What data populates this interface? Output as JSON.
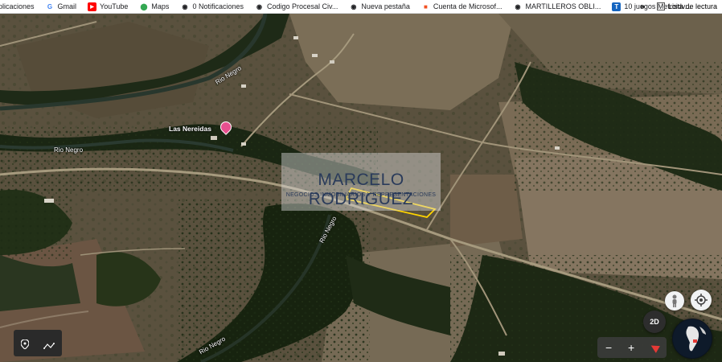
{
  "bookmarks": [
    {
      "label": "plicaciones",
      "icon": "apps-icon",
      "color": "#4285f4"
    },
    {
      "label": "Gmail",
      "icon": "google-icon",
      "color": "#4285f4"
    },
    {
      "label": "YouTube",
      "icon": "youtube-icon",
      "color": "#ff0000"
    },
    {
      "label": "Maps",
      "icon": "maps-icon",
      "color": "#34a853"
    },
    {
      "label": "0 Notificaciones",
      "icon": "globe-icon",
      "color": "#202124"
    },
    {
      "label": "Codigo Procesal Civ...",
      "icon": "globe-icon",
      "color": "#202124"
    },
    {
      "label": "Nueva pestaña",
      "icon": "globe-icon",
      "color": "#202124"
    },
    {
      "label": "Cuenta de Microsof...",
      "icon": "microsoft-icon",
      "color": "#f25022"
    },
    {
      "label": "MARTILLEROS OBLI...",
      "icon": "globe-icon",
      "color": "#202124"
    },
    {
      "label": "10 juegos Metroidv...",
      "icon": "site-icon",
      "color": "#1565c0"
    }
  ],
  "more_label": "»",
  "reading_list": {
    "label": "Lista de lectura",
    "icon": "reading-list-icon"
  },
  "map": {
    "labels": {
      "rio_negro_1": "Rio Negro",
      "rio_negro_2": "Rio Negro",
      "rio_negro_3": "Rio Negro",
      "rio_negro_4": "Rio Negro",
      "las_nereidas": "Las Nereidas"
    },
    "place_icon": "lodging-pin-icon",
    "watermark": {
      "title": "MARCELO RODRIGUEZ",
      "subtitle": "NEGOCIOS INMOBILIARIOS Y REPRESENTACIONES"
    },
    "parcel_outline_color": "#ffd400",
    "controls": {
      "view_mode": "2D",
      "zoom_out": "−",
      "zoom_in": "+"
    }
  }
}
